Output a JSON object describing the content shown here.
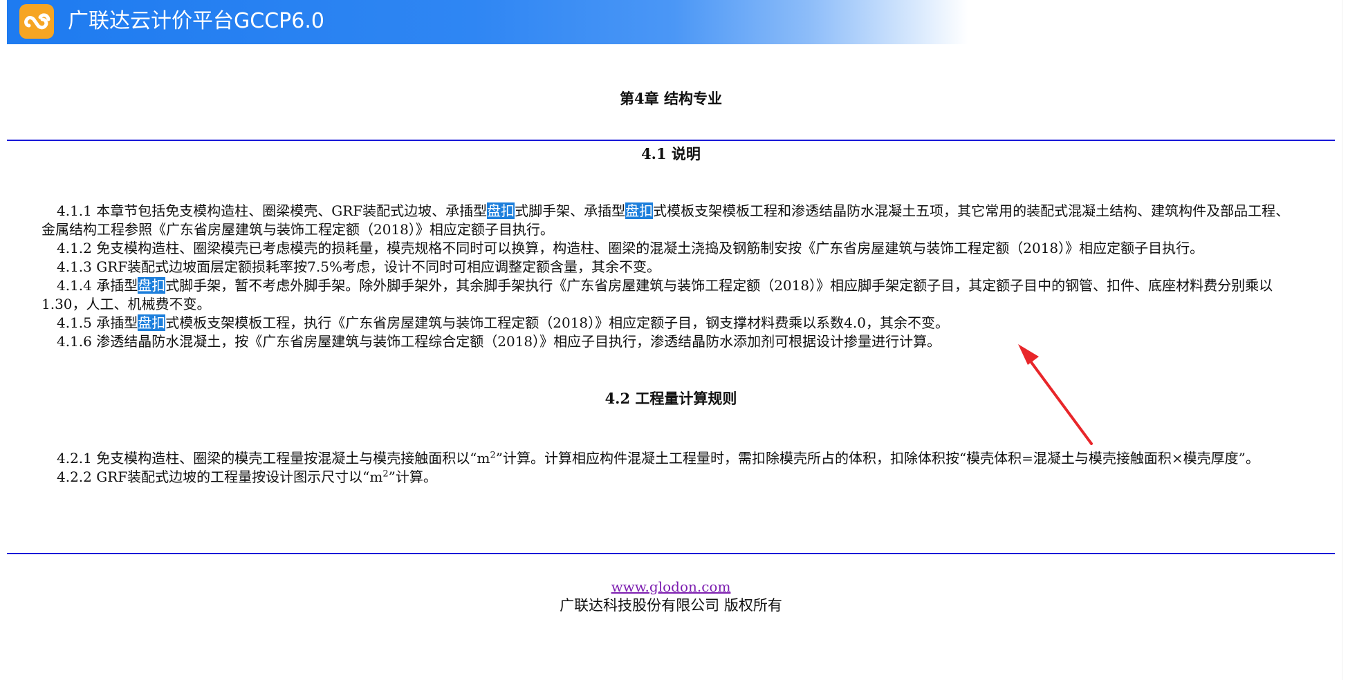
{
  "app": {
    "title": "广联达云计价平台GCCP6.0"
  },
  "chapter": {
    "title": "第4章 结构专业"
  },
  "section1": {
    "title": "4.1 说明",
    "p1": {
      "a": "4.1.1 本章节包括免支模构造柱、圈梁模壳、GRF装配式边坡、承插型",
      "hl1": "盘扣",
      "b": "式脚手架、承插型",
      "hl2": "盘扣",
      "c": "式模板支架模板工程和渗透结晶防水混凝土五项，其它常用的装配式混凝土结构、建筑构件及部品工程、金属结构工程参照《广东省房屋建筑与装饰工程定额（2018）》相应定额子目执行。"
    },
    "p2": "4.1.2 免支模构造柱、圈梁模壳已考虑模壳的损耗量，模壳规格不同时可以换算，构造柱、圈梁的混凝土浇捣及钢筋制安按《广东省房屋建筑与装饰工程定额（2018）》相应定额子目执行。",
    "p3": "4.1.3 GRF装配式边坡面层定额损耗率按7.5%考虑，设计不同时可相应调整定额含量，其余不变。",
    "p4": {
      "a": "4.1.4 承插型",
      "hl": "盘扣",
      "b": "式脚手架，暂不考虑外脚手架。除外脚手架外，其余脚手架执行《广东省房屋建筑与装饰工程定额（2018）》相应脚手架定额子目，其定额子目中的钢管、扣件、底座材料费分别乘以1.30，人工、机械费不变。"
    },
    "p5": {
      "a": "4.1.5 承插型",
      "hl": "盘扣",
      "b": "式模板支架模板工程，执行《广东省房屋建筑与装饰工程定额（2018）》相应定额子目，钢支撑材料费乘以系数4.0，其余不变。"
    },
    "p6": "4.1.6 渗透结晶防水混凝土，按《广东省房屋建筑与装饰工程综合定额（2018）》相应子目执行，渗透结晶防水添加剂可根据设计掺量进行计算。"
  },
  "section2": {
    "title": "4.2 工程量计算规则",
    "p1": {
      "a": "4.2.1 免支模构造柱、圈梁的模壳工程量按混凝土与模壳接触面积以“m",
      "sup": "2",
      "b": "”计算。计算相应构件混凝土工程量时，需扣除模壳所占的体积，扣除体积按“模壳体积=混凝土与模壳接触面积×模壳厚度”。"
    },
    "p2": {
      "a": "4.2.2 GRF装配式边坡的工程量按设计图示尺寸以“m",
      "sup": "2",
      "b": "”计算。"
    }
  },
  "footer": {
    "link": "www.glodon.com",
    "copyright": "广联达科技股份有限公司 版权所有"
  },
  "colors": {
    "header_blue": "#1e7bf0",
    "logo_orange": "#f6a523",
    "rule_blue": "#1818d8",
    "highlight": "#1d7fdc",
    "link_purple": "#7d1fb0",
    "annotation_arrow": "#e8262a"
  }
}
